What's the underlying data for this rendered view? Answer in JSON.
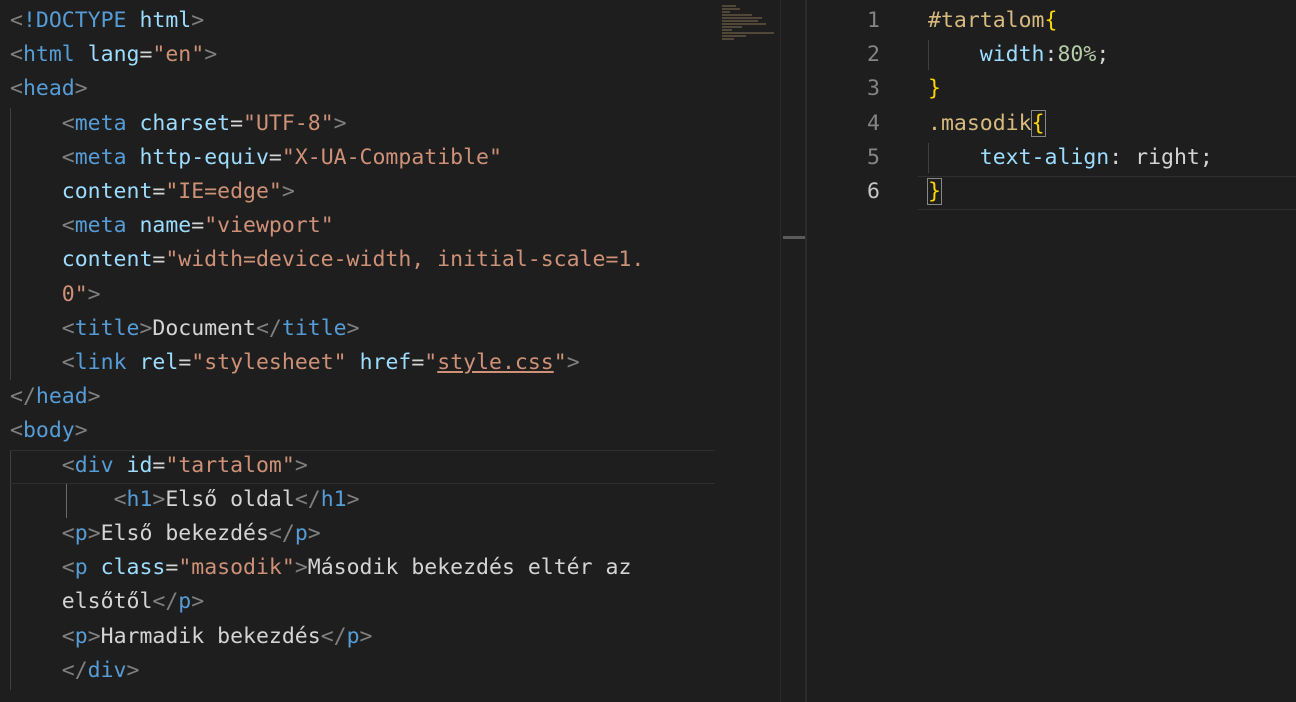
{
  "html_editor": {
    "lines": [
      {
        "indent": "",
        "parts": [
          [
            "br",
            "<"
          ],
          [
            "tag",
            "!DOCTYPE"
          ],
          [
            "txt",
            " "
          ],
          [
            "attr",
            "html"
          ],
          [
            "br",
            ">"
          ]
        ]
      },
      {
        "indent": "",
        "parts": [
          [
            "br",
            "<"
          ],
          [
            "tag",
            "html"
          ],
          [
            "txt",
            " "
          ],
          [
            "attr",
            "lang"
          ],
          [
            "txt",
            "="
          ],
          [
            "str",
            "\"en\""
          ],
          [
            "br",
            ">"
          ]
        ]
      },
      {
        "indent": "",
        "parts": [
          [
            "br",
            "<"
          ],
          [
            "tag",
            "head"
          ],
          [
            "br",
            ">"
          ]
        ]
      },
      {
        "indent": "    ",
        "parts": [
          [
            "br",
            "<"
          ],
          [
            "tag",
            "meta"
          ],
          [
            "txt",
            " "
          ],
          [
            "attr",
            "charset"
          ],
          [
            "txt",
            "="
          ],
          [
            "str",
            "\"UTF-8\""
          ],
          [
            "br",
            ">"
          ]
        ]
      },
      {
        "indent": "    ",
        "parts": [
          [
            "br",
            "<"
          ],
          [
            "tag",
            "meta"
          ],
          [
            "txt",
            " "
          ],
          [
            "attr",
            "http-equiv"
          ],
          [
            "txt",
            "="
          ],
          [
            "str",
            "\"X-UA-Compatible\""
          ]
        ]
      },
      {
        "indent": "    ",
        "parts": [
          [
            "attr",
            "content"
          ],
          [
            "txt",
            "="
          ],
          [
            "str",
            "\"IE=edge\""
          ],
          [
            "br",
            ">"
          ]
        ]
      },
      {
        "indent": "    ",
        "parts": [
          [
            "br",
            "<"
          ],
          [
            "tag",
            "meta"
          ],
          [
            "txt",
            " "
          ],
          [
            "attr",
            "name"
          ],
          [
            "txt",
            "="
          ],
          [
            "str",
            "\"viewport\""
          ]
        ]
      },
      {
        "indent": "    ",
        "parts": [
          [
            "attr",
            "content"
          ],
          [
            "txt",
            "="
          ],
          [
            "str",
            "\"width=device-width, initial-scale=1."
          ]
        ]
      },
      {
        "indent": "    ",
        "parts": [
          [
            "str",
            "0\""
          ],
          [
            "br",
            ">"
          ]
        ]
      },
      {
        "indent": "    ",
        "parts": [
          [
            "br",
            "<"
          ],
          [
            "tag",
            "title"
          ],
          [
            "br",
            ">"
          ],
          [
            "txt",
            "Document"
          ],
          [
            "br",
            "</"
          ],
          [
            "tag",
            "title"
          ],
          [
            "br",
            ">"
          ]
        ]
      },
      {
        "indent": "    ",
        "parts": [
          [
            "br",
            "<"
          ],
          [
            "tag",
            "link"
          ],
          [
            "txt",
            " "
          ],
          [
            "attr",
            "rel"
          ],
          [
            "txt",
            "="
          ],
          [
            "str",
            "\"stylesheet\""
          ],
          [
            "txt",
            " "
          ],
          [
            "attr",
            "href"
          ],
          [
            "txt",
            "="
          ],
          [
            "str",
            "\""
          ],
          [
            "str link",
            "style.css"
          ],
          [
            "str",
            "\""
          ],
          [
            "br",
            ">"
          ]
        ]
      },
      {
        "indent": "",
        "parts": [
          [
            "br",
            "</"
          ],
          [
            "tag",
            "head"
          ],
          [
            "br",
            ">"
          ]
        ]
      },
      {
        "indent": "",
        "parts": [
          [
            "br",
            "<"
          ],
          [
            "tag",
            "body"
          ],
          [
            "br",
            ">"
          ]
        ]
      },
      {
        "indent": "    ",
        "parts": [
          [
            "br",
            "<"
          ],
          [
            "tag",
            "div"
          ],
          [
            "txt",
            " "
          ],
          [
            "attr",
            "id"
          ],
          [
            "txt",
            "="
          ],
          [
            "str",
            "\"tartalom\""
          ],
          [
            "br",
            ">"
          ]
        ]
      },
      {
        "indent": "        ",
        "parts": [
          [
            "br",
            "<"
          ],
          [
            "tag",
            "h1"
          ],
          [
            "br",
            ">"
          ],
          [
            "txt",
            "Első oldal"
          ],
          [
            "br",
            "</"
          ],
          [
            "tag",
            "h1"
          ],
          [
            "br",
            ">"
          ]
        ]
      },
      {
        "indent": "    ",
        "parts": [
          [
            "br",
            "<"
          ],
          [
            "tag",
            "p"
          ],
          [
            "br",
            ">"
          ],
          [
            "txt",
            "Első bekezdés"
          ],
          [
            "br",
            "</"
          ],
          [
            "tag",
            "p"
          ],
          [
            "br",
            ">"
          ]
        ]
      },
      {
        "indent": "    ",
        "parts": [
          [
            "br",
            "<"
          ],
          [
            "tag",
            "p"
          ],
          [
            "txt",
            " "
          ],
          [
            "attr",
            "class"
          ],
          [
            "txt",
            "="
          ],
          [
            "str",
            "\"masodik\""
          ],
          [
            "br",
            ">"
          ],
          [
            "txt",
            "Második bekezdés eltér az"
          ]
        ]
      },
      {
        "indent": "    ",
        "parts": [
          [
            "txt",
            "elsőtől"
          ],
          [
            "br",
            "</"
          ],
          [
            "tag",
            "p"
          ],
          [
            "br",
            ">"
          ]
        ]
      },
      {
        "indent": "    ",
        "parts": [
          [
            "br",
            "<"
          ],
          [
            "tag",
            "p"
          ],
          [
            "br",
            ">"
          ],
          [
            "txt",
            "Harmadik bekezdés"
          ],
          [
            "br",
            "</"
          ],
          [
            "tag",
            "p"
          ],
          [
            "br",
            ">"
          ]
        ]
      },
      {
        "indent": "    ",
        "parts": [
          [
            "br",
            "</"
          ],
          [
            "tag",
            "div"
          ],
          [
            "br",
            ">"
          ]
        ]
      }
    ]
  },
  "css_editor": {
    "active_line": 6,
    "lines": [
      {
        "num": "1",
        "indent": "",
        "parts": [
          [
            "sel",
            "#tartalom"
          ],
          [
            "brace",
            "{"
          ]
        ]
      },
      {
        "num": "2",
        "indent": "    ",
        "parts": [
          [
            "attr",
            "width"
          ],
          [
            "txt",
            ":"
          ],
          [
            "num",
            "80%"
          ],
          [
            "txt",
            ";"
          ]
        ]
      },
      {
        "num": "3",
        "indent": "",
        "parts": [
          [
            "brace",
            "}"
          ]
        ]
      },
      {
        "num": "4",
        "indent": "",
        "parts": [
          [
            "sel",
            ".masodik"
          ],
          [
            "brace brmatch",
            "{"
          ]
        ]
      },
      {
        "num": "5",
        "indent": "    ",
        "parts": [
          [
            "attr",
            "text-align"
          ],
          [
            "txt",
            ": right;"
          ]
        ]
      },
      {
        "num": "6",
        "indent": "",
        "parts": [
          [
            "brace brmatch",
            "}"
          ]
        ]
      }
    ]
  }
}
